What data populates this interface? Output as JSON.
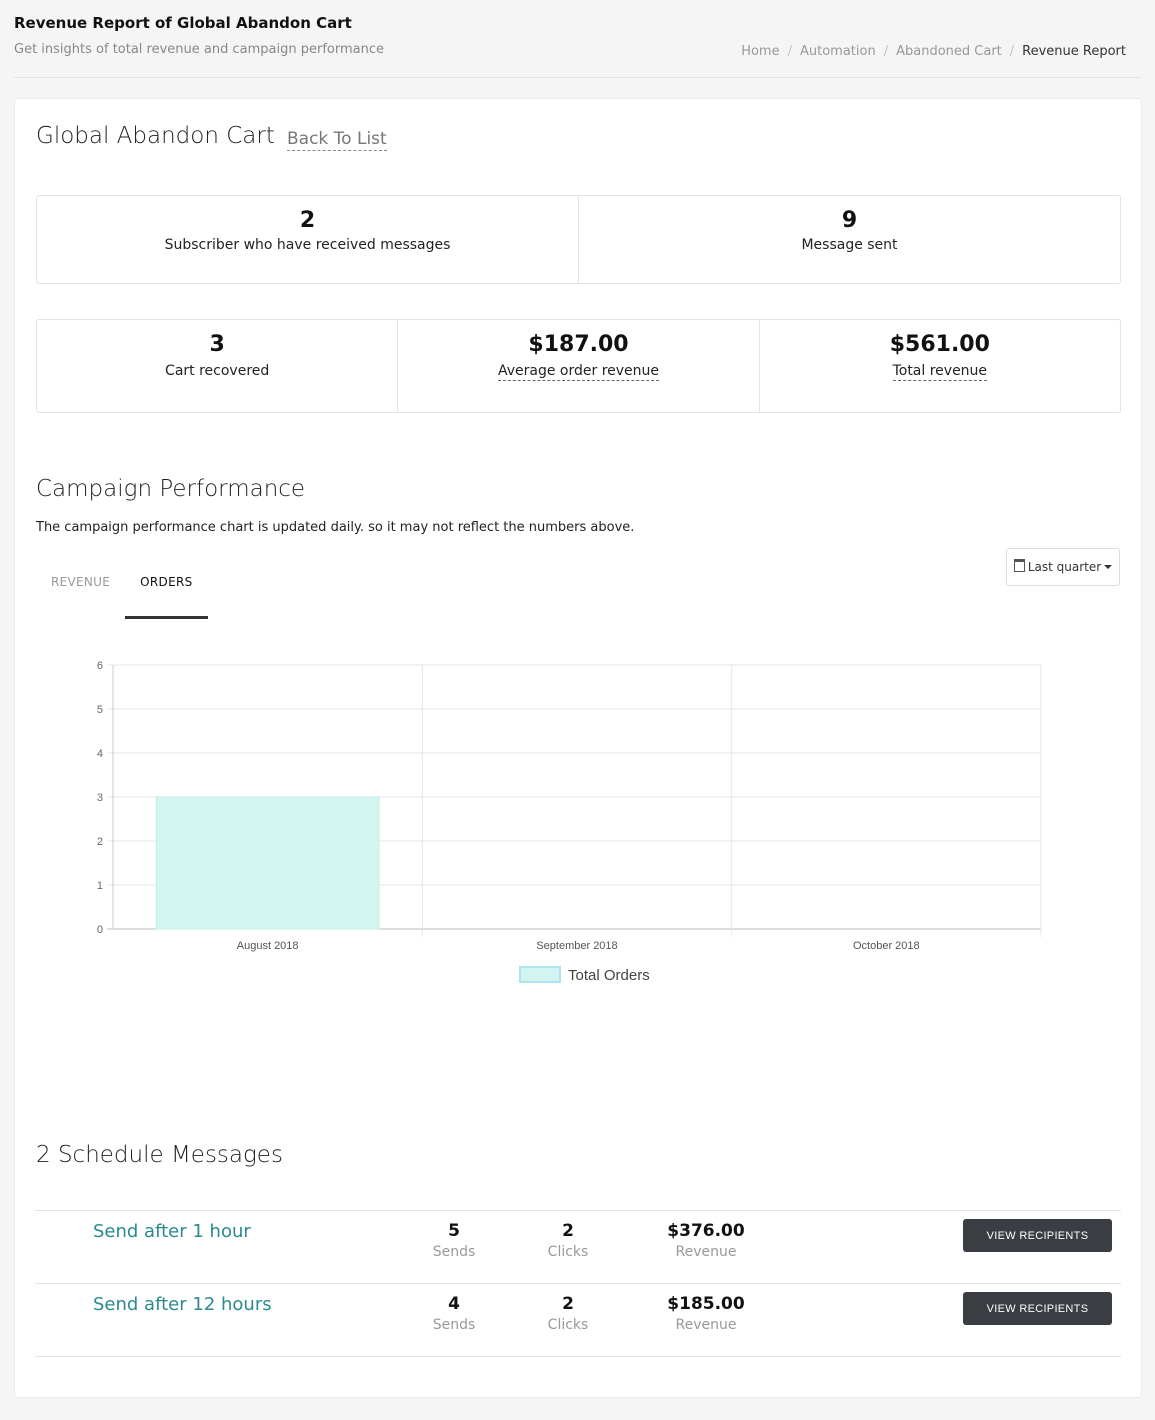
{
  "header": {
    "title": "Revenue Report of Global Abandon Cart",
    "subtitle": "Get insights of total revenue and campaign performance",
    "breadcrumb": [
      "Home",
      "Automation",
      "Abandoned Cart",
      "Revenue Report"
    ]
  },
  "cart": {
    "title": "Global Abandon Cart",
    "back_label": "Back To List"
  },
  "stats": {
    "subscribers_value": "2",
    "subscribers_label": "Subscriber who have received messages",
    "messages_value": "9",
    "messages_label": "Message sent",
    "recovered_value": "3",
    "recovered_label": "Cart recovered",
    "avg_value": "$187.00",
    "avg_label": "Average order revenue",
    "total_value": "$561.00",
    "total_label": "Total revenue"
  },
  "performance": {
    "title": "Campaign Performance",
    "note": "The campaign performance chart is updated daily. so it may not reflect the numbers above.",
    "tabs": [
      "REVENUE",
      "ORDERS"
    ],
    "active_tab": "ORDERS",
    "range_label": "Last quarter"
  },
  "chart_data": {
    "type": "bar",
    "categories": [
      "August 2018",
      "September 2018",
      "October 2018"
    ],
    "series": [
      {
        "name": "Total Orders",
        "values": [
          3,
          0,
          0
        ]
      }
    ],
    "ylim": [
      0,
      6
    ],
    "yticks": [
      0,
      1,
      2,
      3,
      4,
      5,
      6
    ],
    "grid": true,
    "legend": "bottom",
    "colors": {
      "bar_fill": "#d2f5f2",
      "bar_stroke": "#c4eee4",
      "legend_fill": "#d2f5f2",
      "legend_stroke": "#aee4ef"
    }
  },
  "schedule": {
    "title": "2 Schedule Messages",
    "messages": [
      {
        "name": "Send after 1 hour",
        "sends": "5",
        "sends_label": "Sends",
        "clicks": "2",
        "clicks_label": "Clicks",
        "revenue": "$376.00",
        "revenue_label": "Revenue",
        "button": "VIEW RECIPIENTS"
      },
      {
        "name": "Send after 12 hours",
        "sends": "4",
        "sends_label": "Sends",
        "clicks": "2",
        "clicks_label": "Clicks",
        "revenue": "$185.00",
        "revenue_label": "Revenue",
        "button": "VIEW RECIPIENTS"
      }
    ]
  }
}
